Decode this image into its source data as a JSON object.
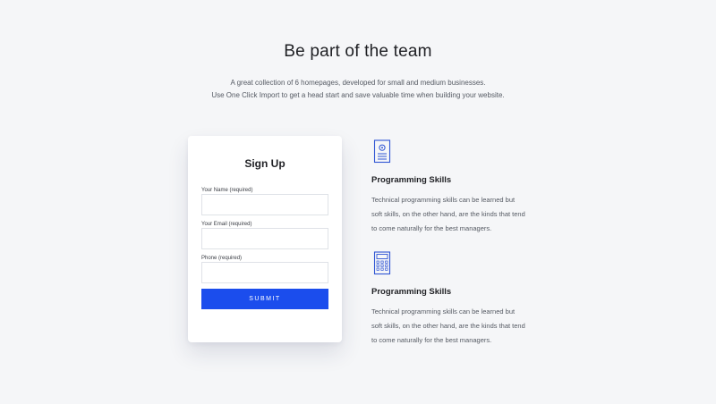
{
  "section": {
    "title": "Be part of the team",
    "subtitle_line1": "A great collection of 6 homepages, developed for small and medium businesses.",
    "subtitle_line2": "Use One Click Import to get a head start and save valuable time when building your website."
  },
  "signup": {
    "title": "Sign Up",
    "name_label": "Your Name (required)",
    "email_label": "Your Email (required)",
    "phone_label": "Phone (required)",
    "name_value": "",
    "email_value": "",
    "phone_value": "",
    "submit_label": "SUBMIT"
  },
  "features": [
    {
      "icon": "id-card-icon",
      "title": "Programming Skills",
      "desc_line1": "Technical programming skills can be learned but",
      "desc_line2": "soft skills, on the other hand, are the kinds that tend",
      "desc_line3": "to come naturally for the best managers."
    },
    {
      "icon": "calculator-icon",
      "title": "Programming Skills",
      "desc_line1": "Technical programming skills can be learned but",
      "desc_line2": "soft skills, on the other hand, are the kinds that tend",
      "desc_line3": "to come naturally for the best managers."
    }
  ],
  "colors": {
    "accent": "#1b4ded",
    "background": "#f5f6f8",
    "icon": "#2f55d4"
  }
}
